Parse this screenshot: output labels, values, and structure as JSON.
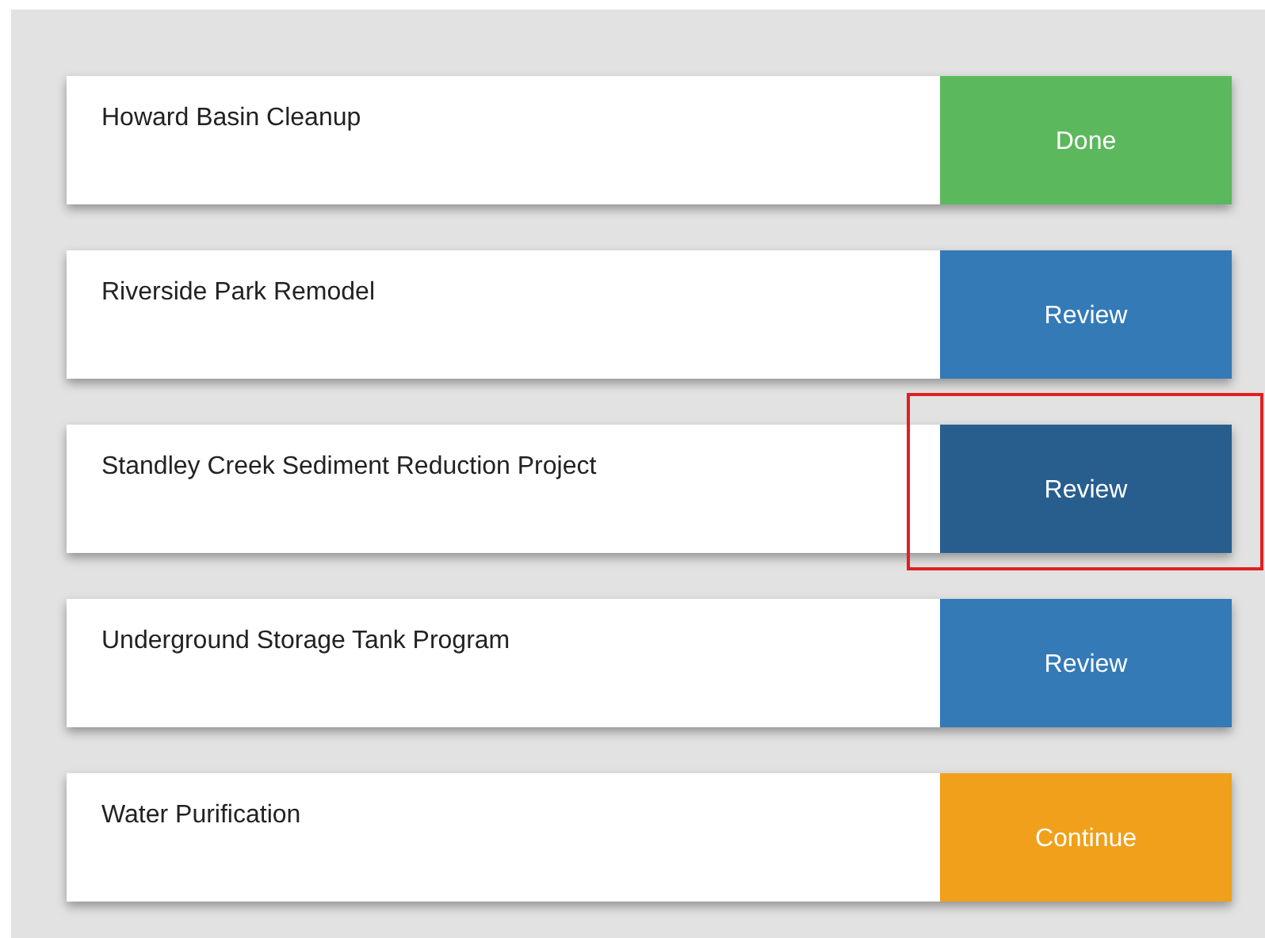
{
  "projects": [
    {
      "name": "Howard Basin Cleanup",
      "action": {
        "label": "Done",
        "kind": "done",
        "hovered": false
      },
      "highlighted": false
    },
    {
      "name": "Riverside Park Remodel",
      "action": {
        "label": "Review",
        "kind": "review",
        "hovered": false
      },
      "highlighted": false
    },
    {
      "name": "Standley Creek Sediment Reduction Project",
      "action": {
        "label": "Review",
        "kind": "review",
        "hovered": true
      },
      "highlighted": true
    },
    {
      "name": "Underground Storage Tank Program",
      "action": {
        "label": "Review",
        "kind": "review",
        "hovered": false
      },
      "highlighted": false
    },
    {
      "name": "Water Purification",
      "action": {
        "label": "Continue",
        "kind": "continue",
        "hovered": false
      },
      "highlighted": false
    }
  ]
}
